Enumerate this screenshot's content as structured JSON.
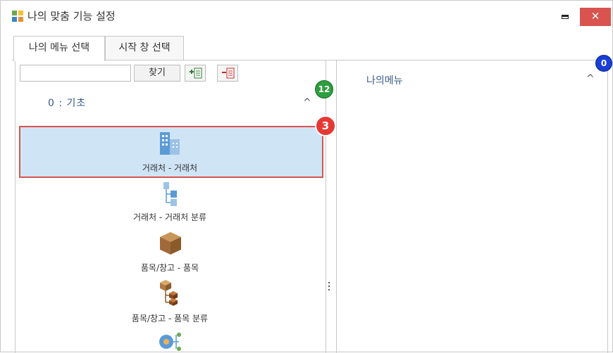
{
  "window": {
    "title": "나의 맞춤 기능 설정",
    "close_label": "✕",
    "colors": {
      "close": "#d9534f",
      "selection_bg": "#cfe4f5",
      "selection_border": "#d9534f",
      "section_text": "#3a5a8a"
    }
  },
  "tabs": [
    {
      "label": "나의 메뉴 선택",
      "active": true
    },
    {
      "label": "시작 창 선택",
      "active": false
    }
  ],
  "left": {
    "search_placeholder": "",
    "find_label": "찾기",
    "add_icon": "add-menu-icon",
    "remove_icon": "remove-menu-icon",
    "section_label": "0  :  기초",
    "count_badge": "12",
    "selected_badge": "3",
    "items": [
      {
        "label": "거래처 - 거래처",
        "icon": "building-icon",
        "selected": true
      },
      {
        "label": "거래처 - 거래처 분류",
        "icon": "hierarchy-icon",
        "selected": false
      },
      {
        "label": "품목/창고 - 품목",
        "icon": "box-icon",
        "selected": false
      },
      {
        "label": "품목/창고 - 품목 분류",
        "icon": "box-tree-icon",
        "selected": false
      },
      {
        "label": "",
        "icon": "category-icon",
        "selected": false
      }
    ]
  },
  "right": {
    "title": "나의메뉴",
    "count_badge": "0"
  }
}
